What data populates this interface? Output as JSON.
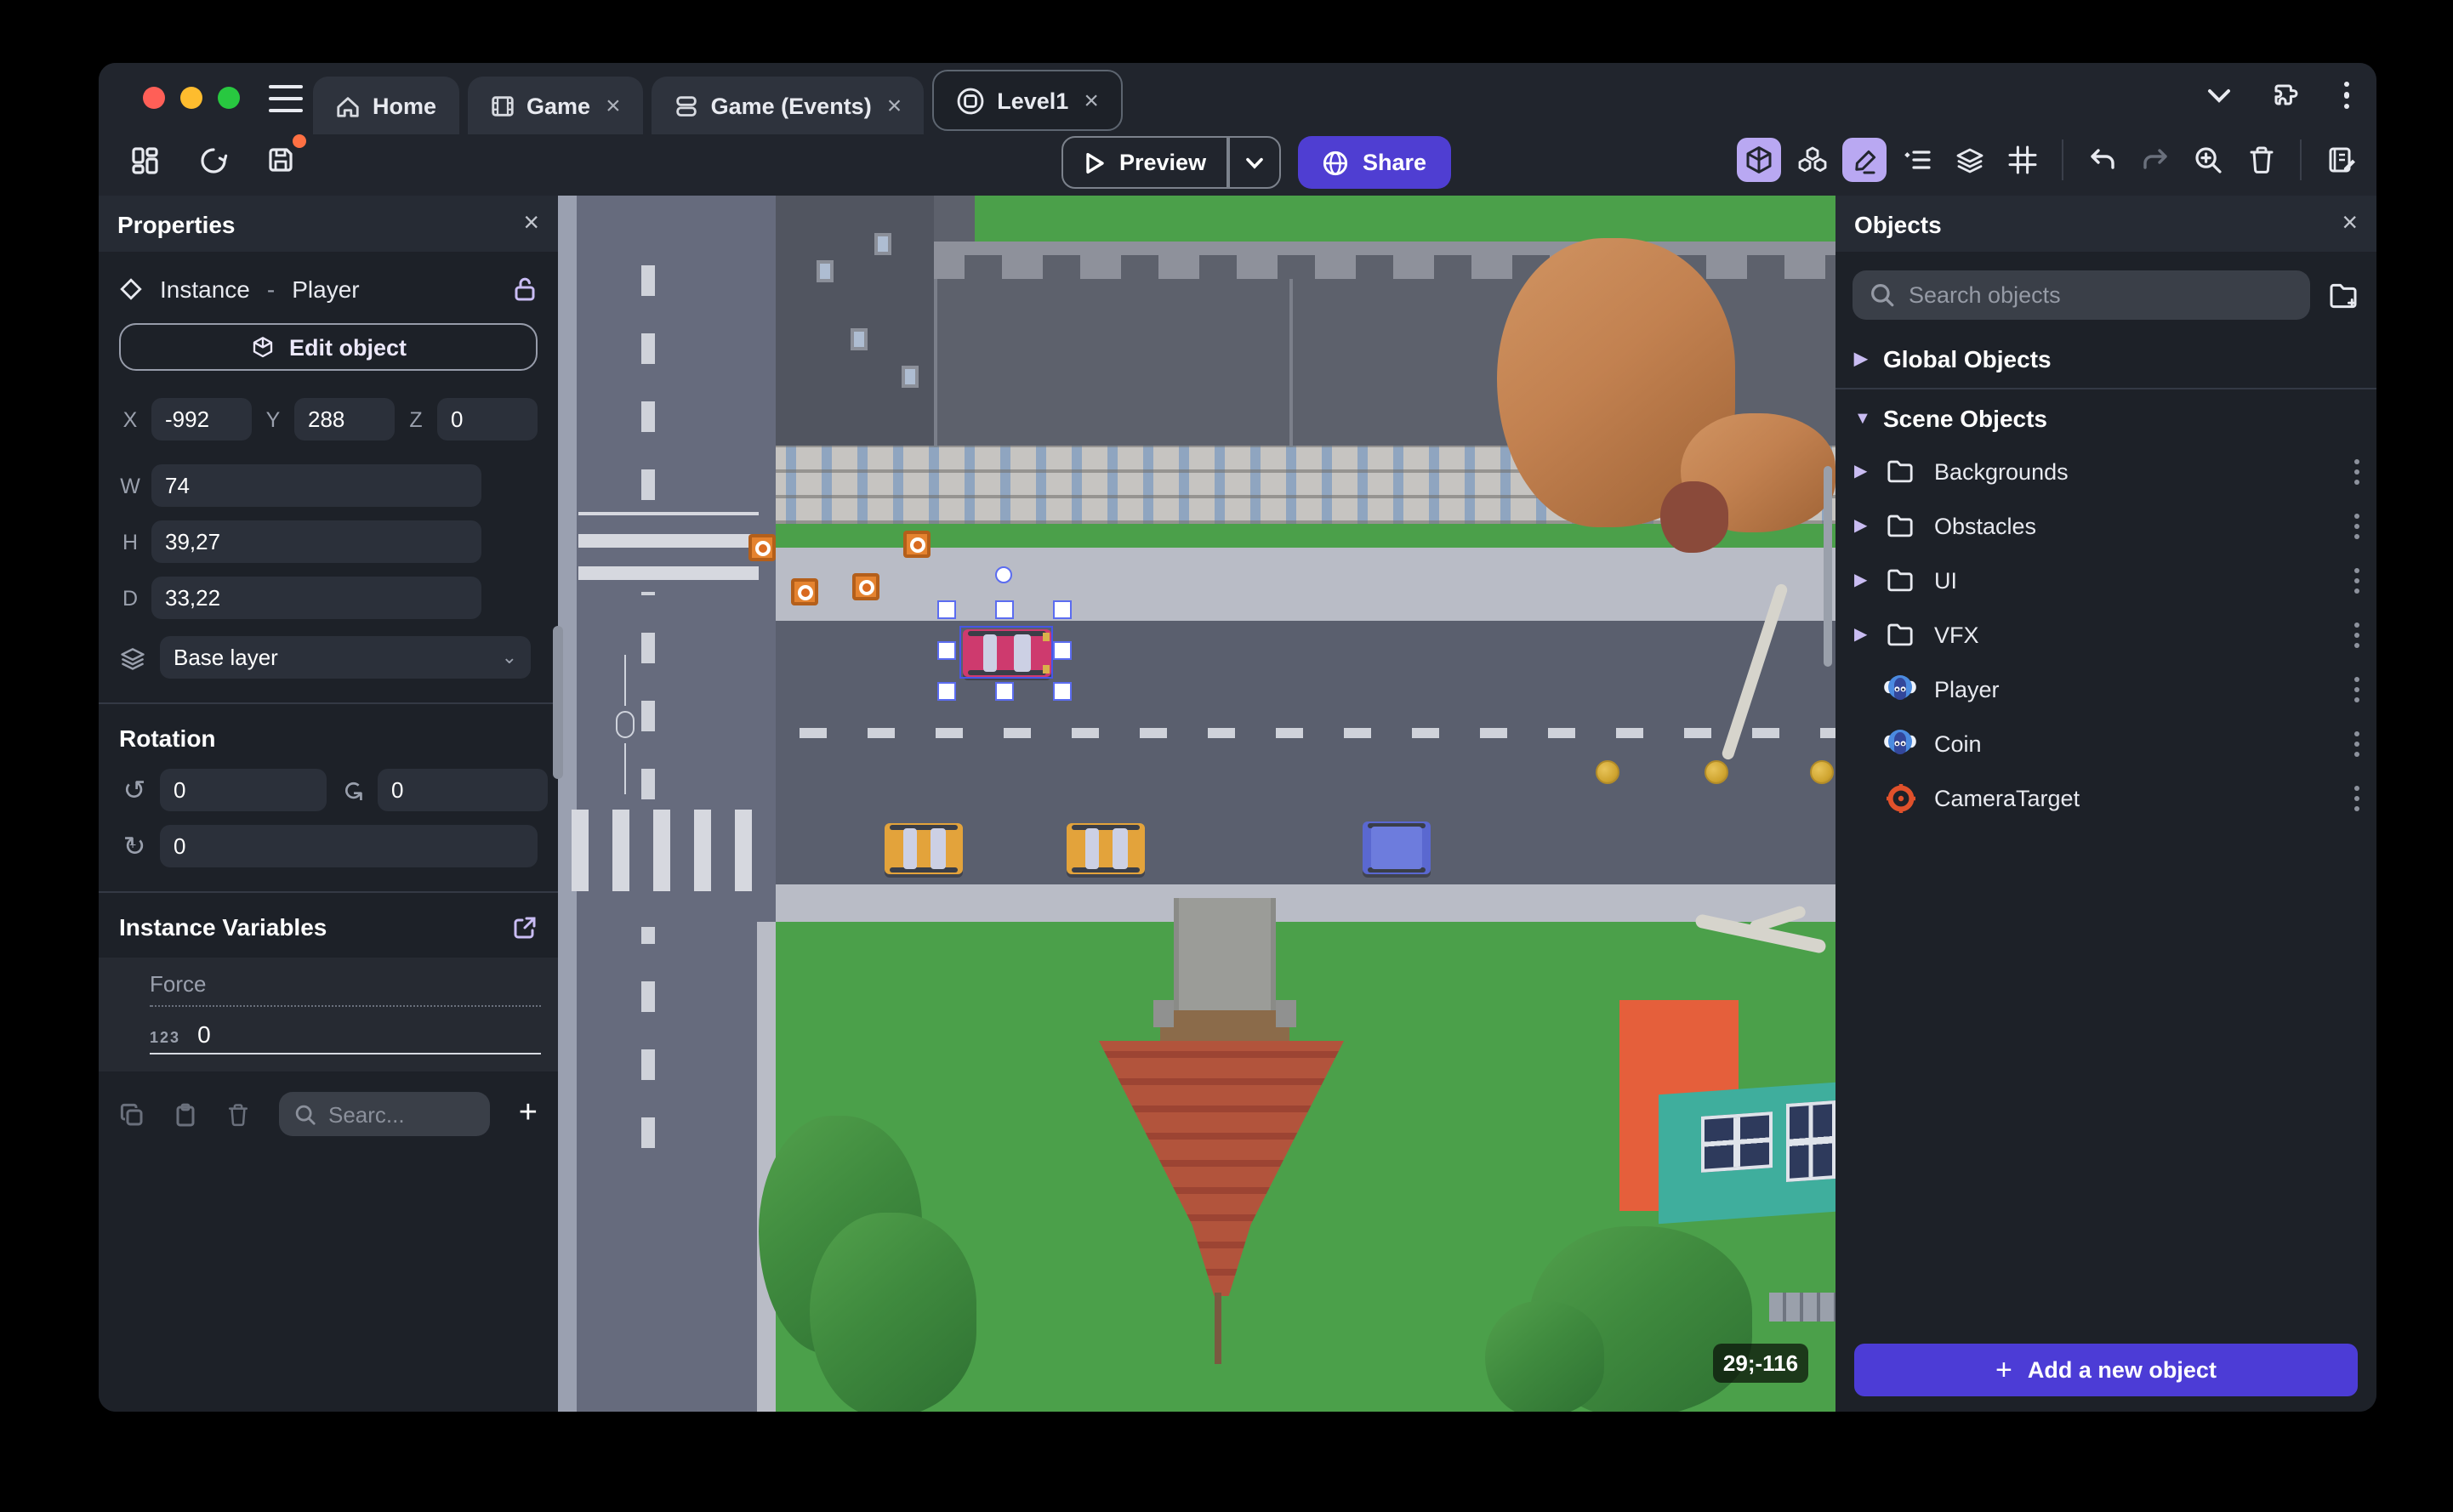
{
  "titlebar": {
    "tabs": [
      {
        "label": "Home",
        "closable": false,
        "active": false
      },
      {
        "label": "Game",
        "closable": true,
        "active": false
      },
      {
        "label": "Game (Events)",
        "closable": true,
        "active": false
      },
      {
        "label": "Level1",
        "closable": true,
        "active": true
      }
    ],
    "close_symbol": "×"
  },
  "toolbar": {
    "preview_label": "Preview",
    "share_label": "Share"
  },
  "properties": {
    "title": "Properties",
    "close_symbol": "×",
    "instance_label": "Instance",
    "separator": "-",
    "object_name": "Player",
    "edit_object_label": "Edit object",
    "coords": {
      "x_label": "X",
      "x": "-992",
      "y_label": "Y",
      "y": "288",
      "z_label": "Z",
      "z": "0"
    },
    "size": {
      "w_label": "W",
      "w": "74",
      "h_label": "H",
      "h": "39,27",
      "d_label": "D",
      "d": "33,22"
    },
    "layer": "Base layer",
    "rotation": {
      "title": "Rotation",
      "x": "0",
      "y": "0",
      "z": "0"
    },
    "variables": {
      "title": "Instance Variables",
      "rows": [
        {
          "name": "Force",
          "type_badge": "123",
          "value": "0"
        }
      ],
      "search_placeholder": "Searc..."
    }
  },
  "objects": {
    "title": "Objects",
    "close_symbol": "×",
    "search_placeholder": "Search objects",
    "global_header": "Global Objects",
    "scene_header": "Scene Objects",
    "items": [
      {
        "label": "Backgrounds",
        "kind": "folder"
      },
      {
        "label": "Obstacles",
        "kind": "folder"
      },
      {
        "label": "UI",
        "kind": "folder"
      },
      {
        "label": "VFX",
        "kind": "folder"
      },
      {
        "label": "Player",
        "kind": "sprite"
      },
      {
        "label": "Coin",
        "kind": "sprite"
      },
      {
        "label": "CameraTarget",
        "kind": "camera"
      }
    ],
    "add_button_label": "Add a new object"
  },
  "canvas": {
    "coordinate_badge": "29;-116"
  },
  "icons": {
    "titlebar": [
      "hamburger-icon",
      "home-icon",
      "film-icon",
      "events-icon",
      "scene-icon",
      "chevron-down-icon",
      "puzzle-icon",
      "kebab-menu-icon"
    ],
    "toolbar": [
      "dashboard-icon",
      "history-icon",
      "save-icon",
      "play-icon",
      "globe-icon",
      "cube-3d-icon",
      "objects-cubes-icon",
      "pencil-icon",
      "instances-list-icon",
      "layers-icon",
      "grid-icon",
      "undo-icon",
      "redo-icon",
      "zoom-in-icon",
      "trash-icon",
      "notebook-edit-icon"
    ],
    "properties": [
      "diamond-icon",
      "lock-open-icon",
      "cube-3d-icon",
      "chain-link-icon",
      "layers-icon",
      "rotate-x-icon",
      "rotate-y-icon",
      "rotate-z-icon",
      "external-link-icon",
      "copy-icon",
      "paste-icon",
      "trash-icon",
      "search-icon",
      "plus-icon"
    ],
    "objects_panel": [
      "search-icon",
      "folder-plus-icon",
      "triangle-right-icon",
      "triangle-down-icon",
      "folder-icon",
      "sprite-monkey-icon",
      "camera-target-icon",
      "kebab-menu-icon",
      "plus-icon"
    ]
  },
  "colors": {
    "accent_purple": "#4f3ed2",
    "active_tool_bg": "#b9a8f2",
    "panel_bg": "#1d2128",
    "titlebar_bg": "#21252d",
    "grass": "#4ba04a",
    "road": "#666b7d",
    "road_dark": "#5a5f6e",
    "sidewalk": "#b9bcc6",
    "selection_blue": "#4656e8",
    "coin_gold": "#d9b33c",
    "pink_car": "#ce3a6e",
    "yellow_car": "#e3a33b",
    "blue_car": "#5a68d0",
    "orange_box": "#e5832f",
    "brick_red": "#b2543c",
    "teal_roof": "#3fae9d",
    "tree_green": "#3f8a3e",
    "tree_autumn": "#c28150",
    "traffic_red": "#ff5f57",
    "traffic_yellow": "#febc2e",
    "traffic_green": "#28c840"
  }
}
